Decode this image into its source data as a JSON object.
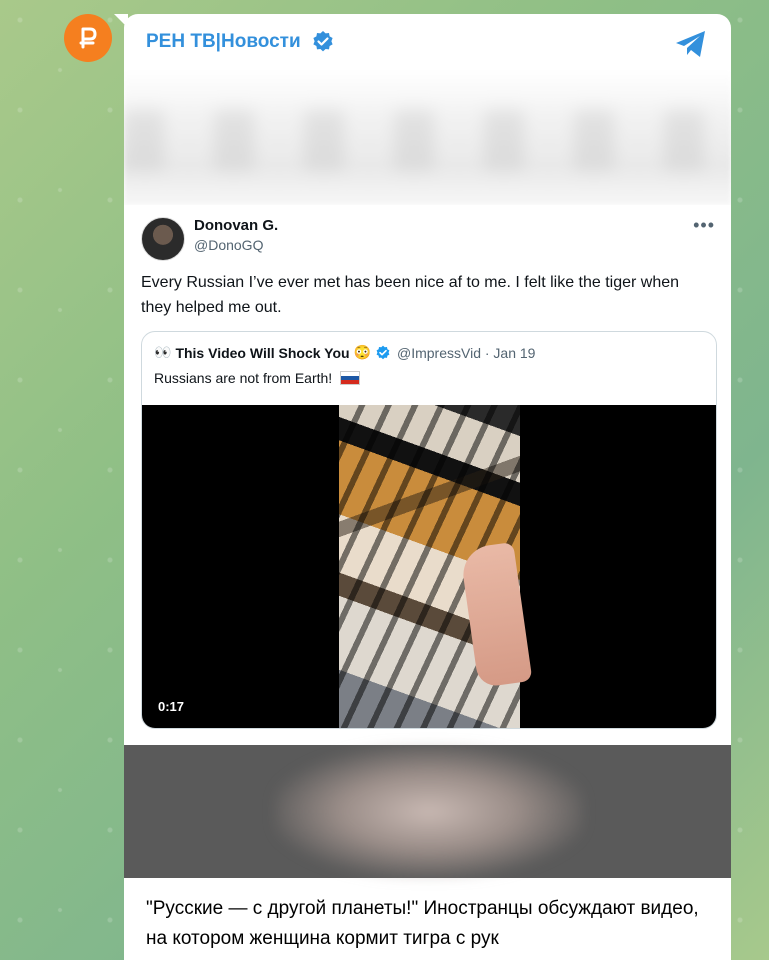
{
  "channel": {
    "name": "РЕН ТВ|Новости",
    "verified": true,
    "avatar_color": "#f57f1f",
    "share_icon": "telegram-plane-icon"
  },
  "tweet": {
    "author_name": "Donovan G.",
    "author_handle": "@DonoGQ",
    "text": "Every Russian I’ve ever met has been nice af to me. I felt like the tiger when they helped me out.",
    "quote": {
      "eyes": "👀",
      "name": "This Video Will Shock You",
      "emoji": "😳",
      "handle_date": "@ImpressVid · Jan 19",
      "text": "Russians are not from Earth!",
      "video_duration": "0:17"
    }
  },
  "caption": "\"Русские — с другой планеты!\" Иностранцы обсуждают видео, на котором женщина кормит тигра с рук",
  "colors": {
    "accent": "#3390dc",
    "verified_twitter": "#1d9bf0"
  }
}
